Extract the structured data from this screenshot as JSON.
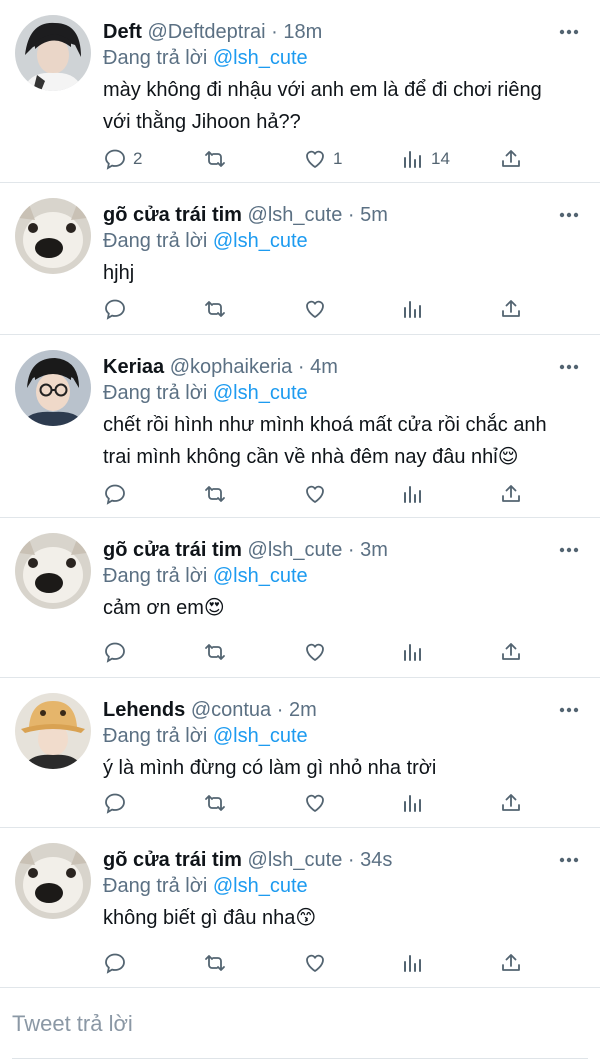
{
  "colors": {
    "link": "#1d9bf0",
    "muted": "#5b7083",
    "text": "#0f1419"
  },
  "tweets": [
    {
      "name": "Deft",
      "handle": "@Deftdeptrai",
      "time": "18m",
      "reply_prefix": "Đang trả lời",
      "reply_to": "@lsh_cute",
      "text_lines": [
        "mày không đi nhậu với anh em là để đi chơi riêng",
        "với thằng Jihoon hả??"
      ],
      "counts": {
        "replies": "2",
        "retweets": "",
        "likes": "1",
        "views": "14"
      },
      "avatar": "person-avatar"
    },
    {
      "name": "gõ cửa trái tim",
      "handle": "@lsh_cute",
      "time": "5m",
      "reply_prefix": "Đang trả lời",
      "reply_to": "@lsh_cute",
      "text_lines": [
        "hjhj"
      ],
      "counts": {
        "replies": "",
        "retweets": "",
        "likes": "",
        "views": ""
      },
      "avatar": "dog-avatar"
    },
    {
      "name": "Keriaa",
      "handle": "@kophaikeria",
      "time": "4m",
      "reply_prefix": "Đang trả lời",
      "reply_to": "@lsh_cute",
      "text_lines": [
        "chết rồi hình như mình khoá mất cửa rồi chắc anh",
        "trai mình không cần về nhà đêm nay đâu nhỉ😌"
      ],
      "counts": {
        "replies": "",
        "retweets": "",
        "likes": "",
        "views": ""
      },
      "avatar": "glasses-person-avatar"
    },
    {
      "name": "gõ cửa trái tim",
      "handle": "@lsh_cute",
      "time": "3m",
      "reply_prefix": "Đang trả lời",
      "reply_to": "@lsh_cute",
      "text_lines": [
        "cảm ơn em😍"
      ],
      "counts": {
        "replies": "",
        "retweets": "",
        "likes": "",
        "views": ""
      },
      "avatar": "dog-avatar"
    },
    {
      "name": "Lehends",
      "handle": "@contua",
      "time": "2m",
      "reply_prefix": "Đang trả lời",
      "reply_to": "@lsh_cute",
      "text_lines": [
        "ý là mình đừng có làm gì nhỏ nha trời"
      ],
      "counts": {
        "replies": "",
        "retweets": "",
        "likes": "",
        "views": ""
      },
      "avatar": "hat-person-avatar"
    },
    {
      "name": "gõ cửa trái tim",
      "handle": "@lsh_cute",
      "time": "34s",
      "reply_prefix": "Đang trả lời",
      "reply_to": "@lsh_cute",
      "text_lines": [
        "không biết gì đâu nha😙"
      ],
      "counts": {
        "replies": "",
        "retweets": "",
        "likes": "",
        "views": ""
      },
      "avatar": "dog-avatar"
    }
  ],
  "compose": {
    "placeholder": "Tweet trả lời"
  }
}
